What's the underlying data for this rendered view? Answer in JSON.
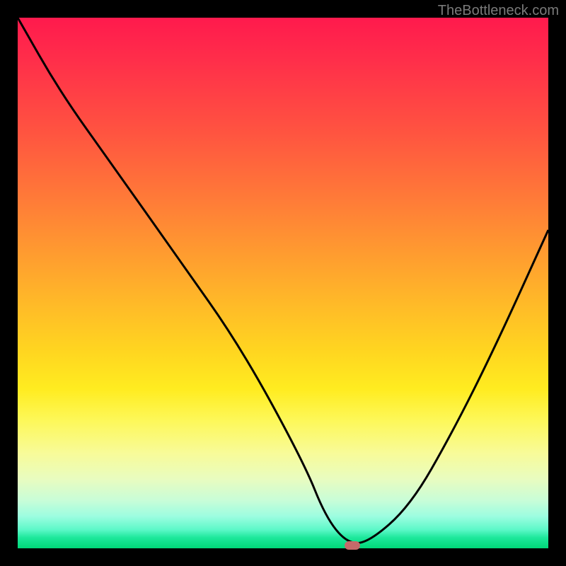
{
  "watermark": "TheBottleneck.com",
  "chart_data": {
    "type": "line",
    "title": "",
    "xlabel": "",
    "ylabel": "",
    "xlim": [
      0,
      100
    ],
    "ylim": [
      0,
      100
    ],
    "x": [
      0,
      8,
      18,
      30,
      42,
      54,
      58,
      62,
      66,
      74,
      82,
      90,
      100
    ],
    "values": [
      100,
      86,
      72,
      55,
      38,
      16,
      6,
      1,
      1,
      8,
      22,
      38,
      60
    ],
    "marker": {
      "x": 63,
      "y": 0.5
    },
    "background_gradient": [
      "#ff1a4d",
      "#ffd620",
      "#00d878"
    ]
  },
  "colors": {
    "curve": "#000000",
    "marker": "#c56a6a",
    "frame": "#000000"
  }
}
